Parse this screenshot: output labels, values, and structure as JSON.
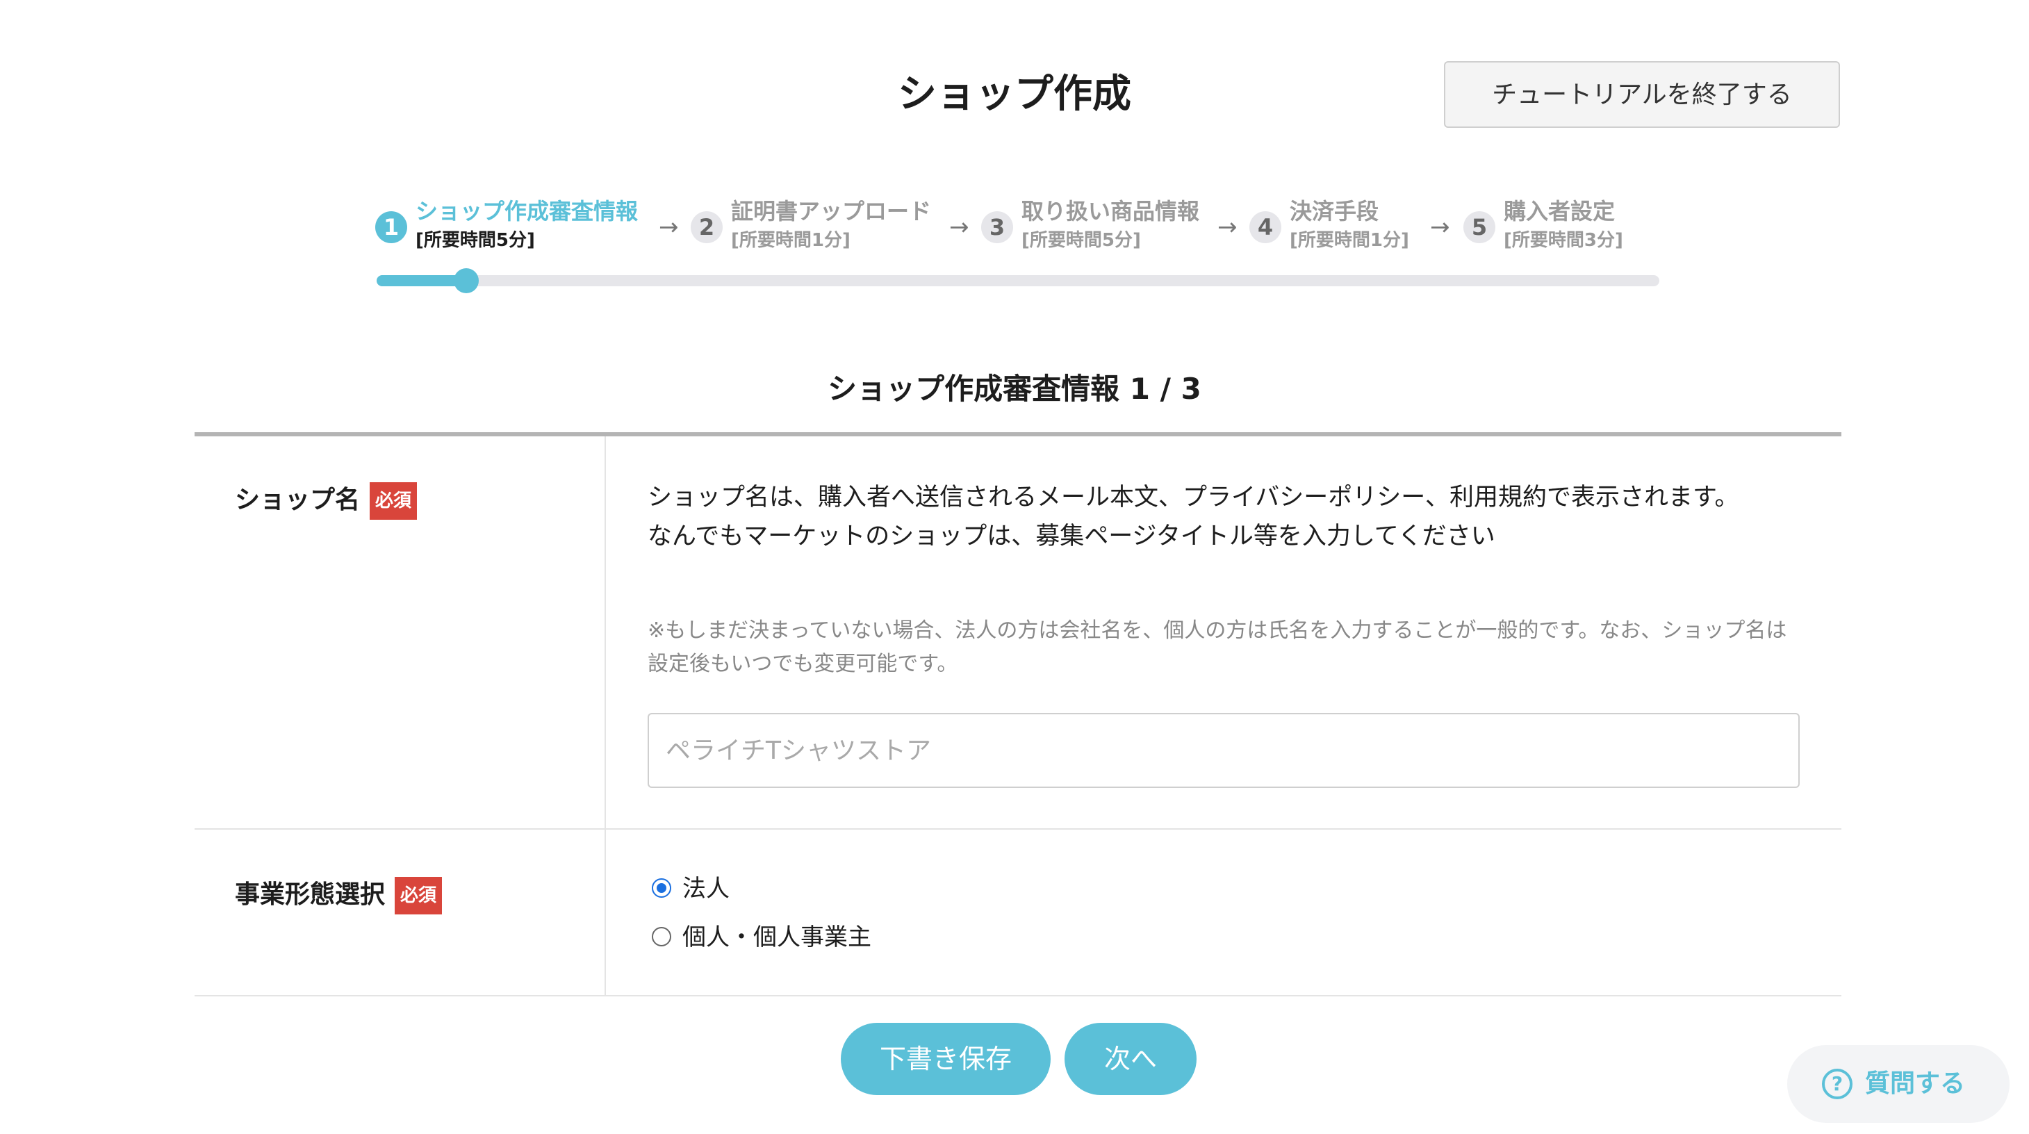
{
  "header": {
    "title": "ショップ作成",
    "end_tutorial_label": "チュートリアルを終了する"
  },
  "stepper": {
    "steps": [
      {
        "number": "1",
        "label": "ショップ作成審査情報",
        "sub": "[所要時間5分]",
        "active": true
      },
      {
        "number": "2",
        "label": "証明書アップロード",
        "sub": "[所要時間1分]",
        "active": false
      },
      {
        "number": "3",
        "label": "取り扱い商品情報",
        "sub": "[所要時間5分]",
        "active": false
      },
      {
        "number": "4",
        "label": "決済手段",
        "sub": "[所要時間1分]",
        "active": false
      },
      {
        "number": "5",
        "label": "購入者設定",
        "sub": "[所要時間3分]",
        "active": false
      }
    ],
    "arrow": "→",
    "progress_fraction": 0.07
  },
  "section": {
    "title": "ショップ作成審査情報 1 / 3"
  },
  "shop_name": {
    "label": "ショップ名",
    "required": "必須",
    "description_line1": "ショップ名は、購入者へ送信されるメール本文、プライバシーポリシー、利用規約で表示されます。",
    "description_line2": "なんでもマーケットのショップは、募集ページタイトル等を入力してください",
    "note": "※もしまだ決まっていない場合、法人の方は会社名を、個人の方は氏名を入力することが一般的です。なお、ショップ名は設定後もいつでも変更可能です。",
    "placeholder": "ペライチTシャツストア",
    "value": ""
  },
  "business_type": {
    "label": "事業形態選択",
    "required": "必須",
    "options": [
      {
        "label": "法人",
        "checked": true
      },
      {
        "label": "個人・個人事業主",
        "checked": false
      }
    ]
  },
  "footer": {
    "save_draft_label": "下書き保存",
    "next_label": "次へ"
  },
  "help": {
    "icon_glyph": "?",
    "label": "質問する"
  },
  "colors": {
    "accent": "#5bc0d8",
    "required_badge": "#d9453b",
    "radio_checked": "#1a6fe0"
  }
}
